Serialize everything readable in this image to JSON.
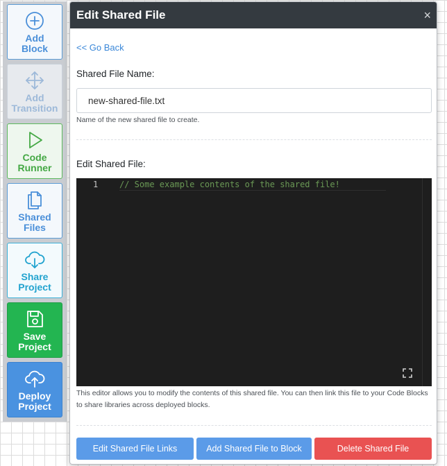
{
  "toolbar": {
    "items": [
      {
        "line1": "Add",
        "line2": "Block",
        "icon": "plus-circle-icon"
      },
      {
        "line1": "Add",
        "line2": "Transition",
        "icon": "move-arrows-icon"
      },
      {
        "line1": "Code",
        "line2": "Runner",
        "icon": "play-icon"
      },
      {
        "line1": "Shared",
        "line2": "Files",
        "icon": "files-icon"
      },
      {
        "line1": "Share",
        "line2": "Project",
        "icon": "cloud-download-icon"
      },
      {
        "line1": "Save",
        "line2": "Project",
        "icon": "floppy-disk-icon"
      },
      {
        "line1": "Deploy",
        "line2": "Project",
        "icon": "cloud-upload-icon"
      }
    ]
  },
  "modal": {
    "title": "Edit Shared File",
    "close_symbol": "×",
    "go_back": "<< Go Back",
    "name_label": "Shared File Name:",
    "name_value": "new-shared-file.txt",
    "name_help": "Name of the new shared file to create.",
    "edit_label": "Edit Shared File:",
    "editor": {
      "line_number": "1",
      "code": "// Some example contents of the shared file!"
    },
    "editor_help": "This editor allows you to modify the contents of this shared file. You can then link this file to your Code Blocks to share libraries across deployed blocks.",
    "buttons": {
      "edit_links": "Edit Shared File Links",
      "add_to_block": "Add Shared File to Block",
      "delete": "Delete Shared File"
    }
  },
  "colors": {
    "header_bg": "#343a40",
    "primary_button": "#5b9be8",
    "danger_button": "#e95252",
    "save_green": "#23b551",
    "deploy_blue": "#4a92e0"
  }
}
